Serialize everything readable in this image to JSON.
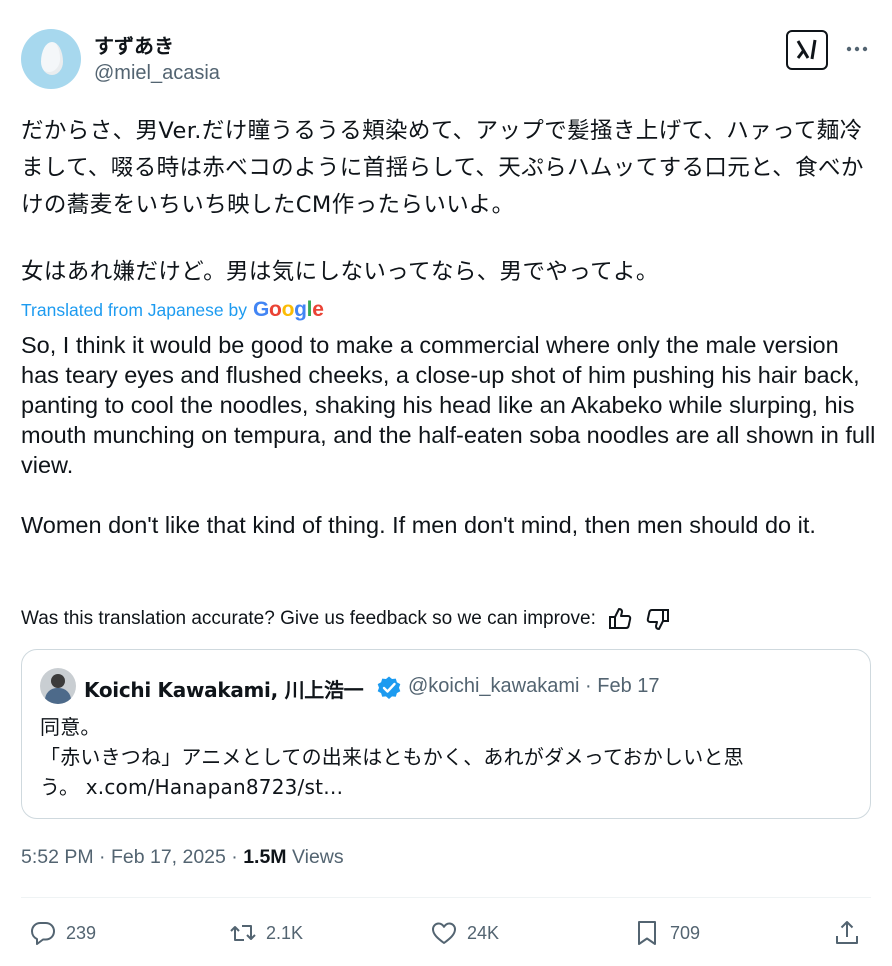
{
  "author": {
    "display_name": "すずあき",
    "handle": "@miel_acasia"
  },
  "header_icons": {
    "grok": "grok-icon",
    "more": "more-horizontal-icon"
  },
  "post": {
    "text_ja_1": "だからさ、男Ver.だけ瞳うるうる頬染めて、アップで髪掻き上げて、ハァって麺冷まして、啜る時は赤べコのように首揺らして、天ぷらハムッてする口元と、食べかけの蕎麦をいちいち映したCM作ったらいいよ。",
    "text_ja_2": "女はあれ嫌だけど。男は気にしないってなら、男でやってよ。",
    "translated_label": "Translated from Japanese by",
    "translated_provider": "Google",
    "text_en_1": "So, I think it would be good to make a commercial where only the male version has teary eyes and flushed cheeks, a close-up shot of him pushing his hair back, panting to cool the noodles, shaking his head like an Akabeko while slurping, his mouth munching on tempura, and the half-eaten soba noodles are all shown in full view.",
    "text_en_2": "Women don't like that kind of thing. If men don't mind, then men should do it.",
    "feedback_prompt": "Was this translation accurate? Give us feedback so we can improve:"
  },
  "quote": {
    "name": "Koichi Kawakami, 川上浩一",
    "handle_date": "@koichi_kawakami · Feb 17",
    "text": "同意。\n「赤いきつね」アニメとしての出来はともかく、あれがダメっておかしいと思う。 x.com/Hanapan8723/st…"
  },
  "meta": {
    "time_date": "5:52 PM · Feb 17, 2025 · ",
    "views_count": "1.5M",
    "views_label": " Views"
  },
  "actions": {
    "replies": "239",
    "reposts": "2.1K",
    "likes": "24K",
    "bookmarks": "709"
  },
  "colors": {
    "link_blue": "#1d9bf0",
    "text_primary": "#0f1419",
    "text_secondary": "#536471",
    "border": "#cfd9de"
  }
}
